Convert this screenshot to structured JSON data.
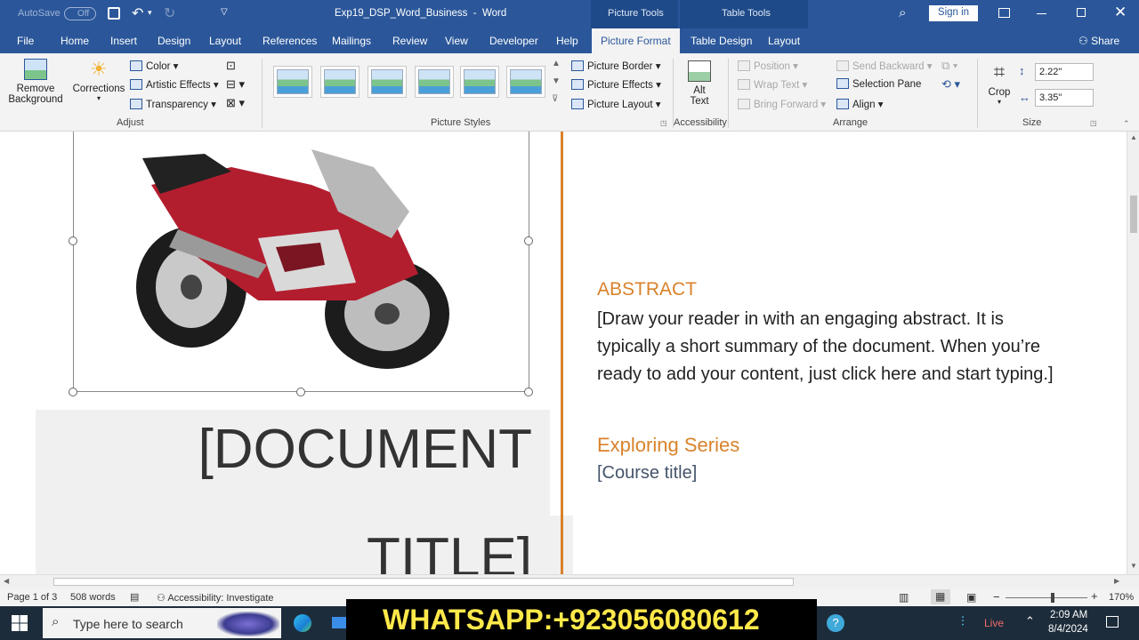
{
  "titlebar": {
    "autosave_label": "AutoSave",
    "autosave_state": "Off",
    "title": "Exp19_DSP_Word_Business  -  Word",
    "sign_in": "Sign in"
  },
  "contextual": {
    "picture_tools": "Picture Tools",
    "table_tools": "Table Tools"
  },
  "tabs": [
    "File",
    "Home",
    "Insert",
    "Design",
    "Layout",
    "References",
    "Mailings",
    "Review",
    "View",
    "Developer",
    "Help",
    "Picture Format",
    "Table Design",
    "Layout"
  ],
  "share": "Share",
  "ribbon": {
    "remove_background": [
      "Remove",
      "Background"
    ],
    "corrections": "Corrections",
    "color": "Color",
    "artistic_effects": "Artistic Effects",
    "transparency": "Transparency",
    "group_adjust": "Adjust",
    "group_picture_styles": "Picture Styles",
    "picture_border": "Picture Border",
    "picture_effects": "Picture Effects",
    "picture_layout": "Picture Layout",
    "alt_text": [
      "Alt",
      "Text"
    ],
    "group_accessibility": "Accessibility",
    "position": "Position",
    "wrap_text": "Wrap Text",
    "bring_forward": "Bring Forward",
    "send_backward": "Send Backward",
    "selection_pane": "Selection Pane",
    "align": "Align",
    "group_arrange": "Arrange",
    "crop": "Crop",
    "height": "2.22\"",
    "width": "3.35\"",
    "group_size": "Size"
  },
  "document": {
    "abstract_heading": "ABSTRACT",
    "abstract_body": "[Draw your reader in with an engaging abstract. It is typically a short summary of the document. When you’re ready to add your content, just click here and start typing.]",
    "series_heading": "Exploring Series",
    "course_title": "[Course title]",
    "doc_title_line1": "[DOCUMENT",
    "doc_title_line2": "TITLE]"
  },
  "status": {
    "page": "Page 1 of 3",
    "words": "508 words",
    "accessibility": "Accessibility: Investigate",
    "zoom": "170%"
  },
  "taskbar": {
    "search_placeholder": "Type here to search",
    "overlay": "WHATSAPP:+923056080612",
    "live": "Live",
    "time": "2:09 AM",
    "date": "8/4/2024"
  },
  "colors": {
    "word_blue": "#2b579a",
    "accent_orange": "#d9822b"
  }
}
